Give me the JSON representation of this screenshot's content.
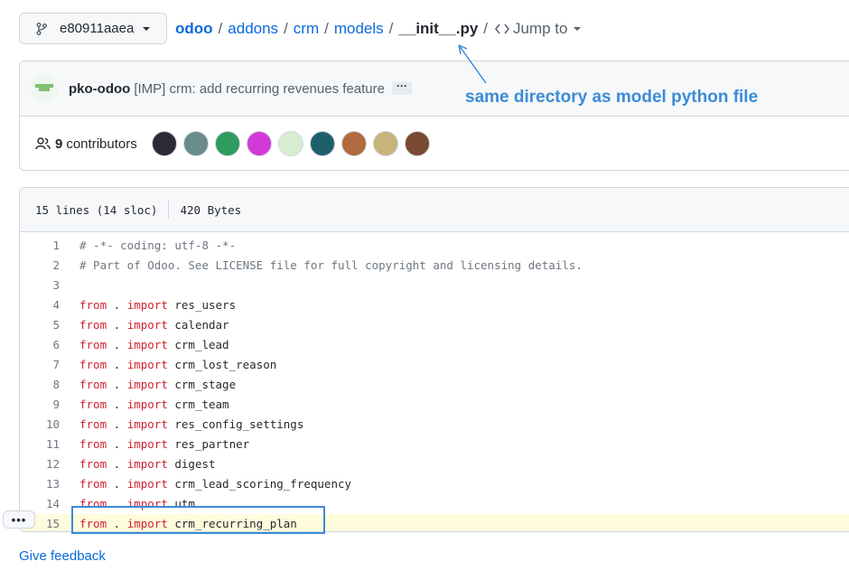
{
  "branch": {
    "name": "e80911aaea"
  },
  "breadcrumb": {
    "root": "odoo",
    "parts": [
      "addons",
      "crm",
      "models"
    ],
    "current": "__init__.py",
    "separator": "/",
    "jump_to": "Jump to"
  },
  "annotation": {
    "text": "same directory as model python file",
    "color": "#3c8bd6"
  },
  "commit": {
    "author": "pko-odoo",
    "message": "[IMP] crm: add recurring revenues feature",
    "more": "···"
  },
  "contributors": {
    "count": "9",
    "label": "contributors",
    "avatar_colors": [
      "#2b2b38",
      "#6a8c8a",
      "#2f9b61",
      "#d23ad8",
      "#d8ecd0",
      "#1f5f6b",
      "#b06b3e",
      "#c8b37a",
      "#7a4a32"
    ]
  },
  "file": {
    "lines_info": "15 lines (14 sloc)",
    "size": "420 Bytes",
    "lines": [
      {
        "n": "1",
        "tokens": [
          {
            "t": "# -*- coding: utf-8 -*-",
            "c": "comment"
          }
        ]
      },
      {
        "n": "2",
        "tokens": [
          {
            "t": "# Part of Odoo. See LICENSE file for full copyright and licensing details.",
            "c": "comment"
          }
        ]
      },
      {
        "n": "3",
        "tokens": []
      },
      {
        "n": "4",
        "tokens": [
          {
            "t": "from",
            "c": "kw"
          },
          {
            "t": " . ",
            "c": "text"
          },
          {
            "t": "import",
            "c": "kw"
          },
          {
            "t": " res_users",
            "c": "text"
          }
        ]
      },
      {
        "n": "5",
        "tokens": [
          {
            "t": "from",
            "c": "kw"
          },
          {
            "t": " . ",
            "c": "text"
          },
          {
            "t": "import",
            "c": "kw"
          },
          {
            "t": " calendar",
            "c": "text"
          }
        ]
      },
      {
        "n": "6",
        "tokens": [
          {
            "t": "from",
            "c": "kw"
          },
          {
            "t": " . ",
            "c": "text"
          },
          {
            "t": "import",
            "c": "kw"
          },
          {
            "t": " crm_lead",
            "c": "text"
          }
        ]
      },
      {
        "n": "7",
        "tokens": [
          {
            "t": "from",
            "c": "kw"
          },
          {
            "t": " . ",
            "c": "text"
          },
          {
            "t": "import",
            "c": "kw"
          },
          {
            "t": " crm_lost_reason",
            "c": "text"
          }
        ]
      },
      {
        "n": "8",
        "tokens": [
          {
            "t": "from",
            "c": "kw"
          },
          {
            "t": " . ",
            "c": "text"
          },
          {
            "t": "import",
            "c": "kw"
          },
          {
            "t": " crm_stage",
            "c": "text"
          }
        ]
      },
      {
        "n": "9",
        "tokens": [
          {
            "t": "from",
            "c": "kw"
          },
          {
            "t": " . ",
            "c": "text"
          },
          {
            "t": "import",
            "c": "kw"
          },
          {
            "t": " crm_team",
            "c": "text"
          }
        ]
      },
      {
        "n": "10",
        "tokens": [
          {
            "t": "from",
            "c": "kw"
          },
          {
            "t": " . ",
            "c": "text"
          },
          {
            "t": "import",
            "c": "kw"
          },
          {
            "t": " res_config_settings",
            "c": "text"
          }
        ]
      },
      {
        "n": "11",
        "tokens": [
          {
            "t": "from",
            "c": "kw"
          },
          {
            "t": " . ",
            "c": "text"
          },
          {
            "t": "import",
            "c": "kw"
          },
          {
            "t": " res_partner",
            "c": "text"
          }
        ]
      },
      {
        "n": "12",
        "tokens": [
          {
            "t": "from",
            "c": "kw"
          },
          {
            "t": " . ",
            "c": "text"
          },
          {
            "t": "import",
            "c": "kw"
          },
          {
            "t": " digest",
            "c": "text"
          }
        ]
      },
      {
        "n": "13",
        "tokens": [
          {
            "t": "from",
            "c": "kw"
          },
          {
            "t": " . ",
            "c": "text"
          },
          {
            "t": "import",
            "c": "kw"
          },
          {
            "t": " crm_lead_scoring_frequency",
            "c": "text"
          }
        ]
      },
      {
        "n": "14",
        "tokens": [
          {
            "t": "from",
            "c": "kw"
          },
          {
            "t": " . ",
            "c": "text"
          },
          {
            "t": "import",
            "c": "kw"
          },
          {
            "t": " utm",
            "c": "text"
          }
        ]
      },
      {
        "n": "15",
        "highlighted": true,
        "tokens": [
          {
            "t": "from",
            "c": "kw"
          },
          {
            "t": " . ",
            "c": "text"
          },
          {
            "t": "import",
            "c": "kw"
          },
          {
            "t": " crm_recurring_plan",
            "c": "text"
          }
        ]
      }
    ]
  },
  "line_menu": "•••",
  "feedback": "Give feedback"
}
